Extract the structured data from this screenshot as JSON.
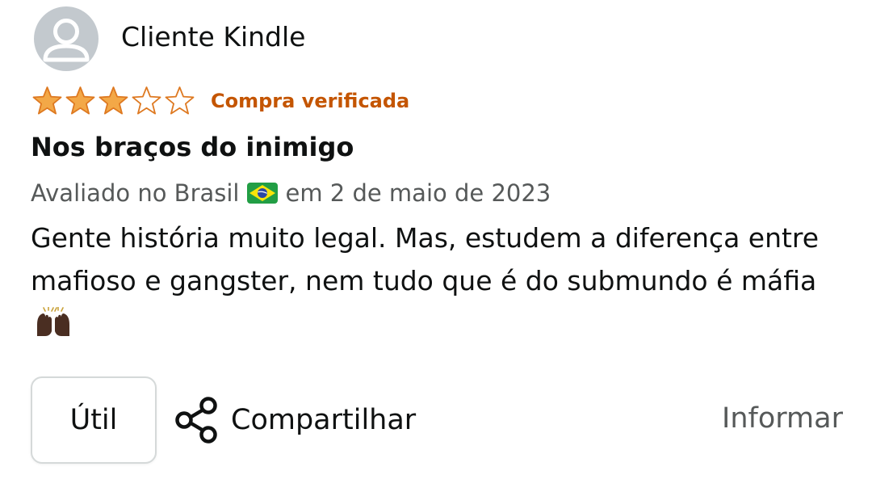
{
  "reviewer": {
    "name": "Cliente Kindle",
    "avatar_icon": "person-silhouette-icon"
  },
  "rating": {
    "stars": 3,
    "max_stars": 5,
    "star_color": "#f3a847",
    "badge": "Compra verificada",
    "badge_color": "#c45500"
  },
  "review": {
    "title": "Nos braços do inimigo",
    "meta_prefix": "Avaliado no Brasil",
    "flag_icon": "brazil-flag-icon",
    "meta_suffix": "em 2 de maio de 2023",
    "body": "Gente história muito legal. Mas, estudem a diferença entre mafioso e gangster, nem tudo que é do submundo é máfia",
    "body_emoji_icon": "raising-hands-icon"
  },
  "actions": {
    "helpful_label": "Útil",
    "share_label": "Compartilhar",
    "share_icon": "share-icon",
    "report_label": "Informar"
  }
}
